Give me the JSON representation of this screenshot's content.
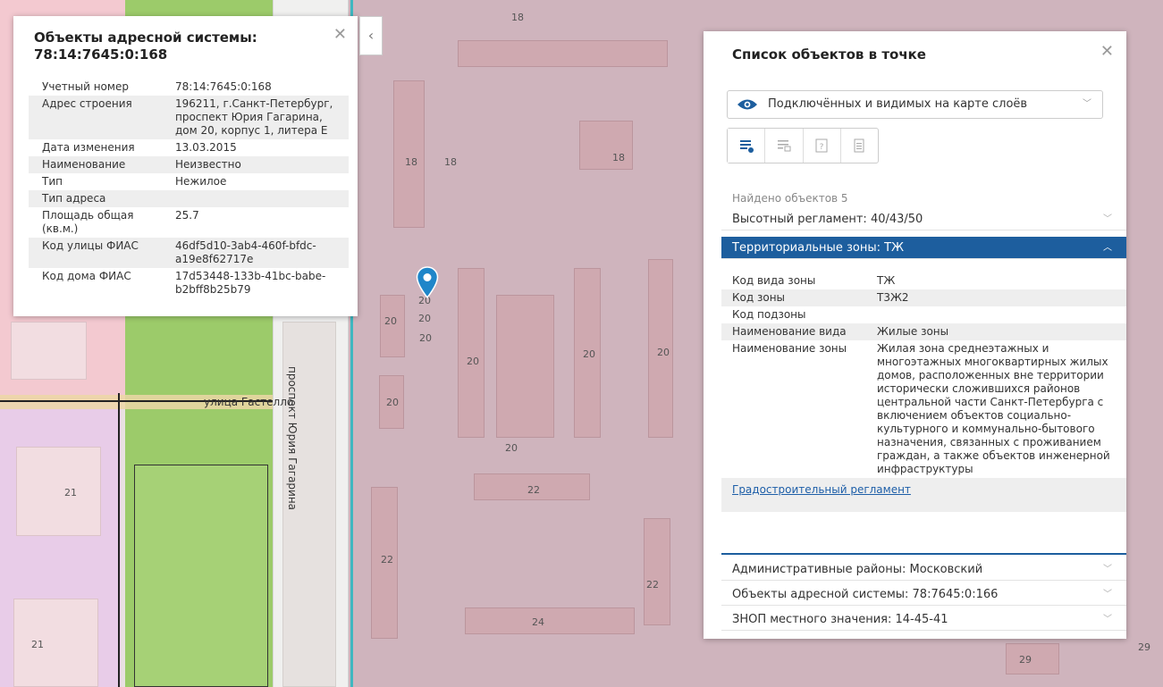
{
  "map": {
    "labels": [
      "18",
      "18",
      "18",
      "18",
      "20",
      "20",
      "20",
      "20",
      "20",
      "20",
      "20",
      "20",
      "20",
      "22",
      "22",
      "22",
      "24",
      "21",
      "21",
      "29",
      "29"
    ],
    "streets": {
      "gastello": "улица Гастелло",
      "gagarina": "проспект Юрия Гагарина"
    }
  },
  "address_panel": {
    "title": "Объекты адресной системы: 78:14:7645:0:168",
    "close_icon": "close-icon",
    "rows": [
      {
        "key": "Учетный номер",
        "value": "78:14:7645:0:168"
      },
      {
        "key": "Адрес строения",
        "value": "196211, г.Санкт-Петербург, проспект Юрия Гагарина, дом 20, корпус 1, литера Е"
      },
      {
        "key": "Дата изменения",
        "value": "13.03.2015"
      },
      {
        "key": "Наименование",
        "value": "Неизвестно"
      },
      {
        "key": "Тип",
        "value": "Нежилое"
      },
      {
        "key": "Тип адреса",
        "value": ""
      },
      {
        "key": "Площадь общая (кв.м.)",
        "value": "25.7"
      },
      {
        "key": "Код улицы ФИАС",
        "value": "46df5d10-3ab4-460f-bfdc-a19e8f62717e"
      },
      {
        "key": "Код дома ФИАС",
        "value": "17d53448-133b-41bc-babe-b2bff8b25b79"
      }
    ],
    "collapse_icon": "chevron-left-icon",
    "collapse_glyph": "‹"
  },
  "list_panel": {
    "title": "Список объектов в точке",
    "close_glyph": "✕",
    "layer_select": "Подключённых и видимых на карте слоёв",
    "found": "Найдено объектов 5",
    "accordion": [
      {
        "label": "Высотный регламент: 40/43/50",
        "open": false
      },
      {
        "label": "Территориальные зоны: ТЖ",
        "open": true
      },
      {
        "label": "Административные районы: Московский",
        "open": false
      },
      {
        "label": "Объекты адресной системы: 78:7645:0:166",
        "open": false
      },
      {
        "label": "ЗНОП местного значения: 14-45-41",
        "open": false
      }
    ],
    "zone_rows": [
      {
        "key": "Код вида зоны",
        "value": "ТЖ"
      },
      {
        "key": "Код зоны",
        "value": "Т3Ж2"
      },
      {
        "key": "Код подзоны",
        "value": ""
      },
      {
        "key": "Наименование вида",
        "value": "Жилые зоны"
      },
      {
        "key": "Наименование зоны",
        "value": "Жилая зона среднеэтажных и многоэтажных многоквартирных жилых домов, расположенных вне территории исторически сложившихся районов центральной части Санкт-Петербурга с включением объектов социально-культурного и коммунально-бытового назначения, связанных с проживанием граждан, а также объектов инженерной инфраструктуры"
      }
    ],
    "regulation_link": "Градостроительный регламент"
  },
  "colors": {
    "accent": "#1d5e9e",
    "pin": "#1f86c9",
    "zone_purple": "#cfb4bd",
    "zone_green": "#9ccb6a"
  }
}
